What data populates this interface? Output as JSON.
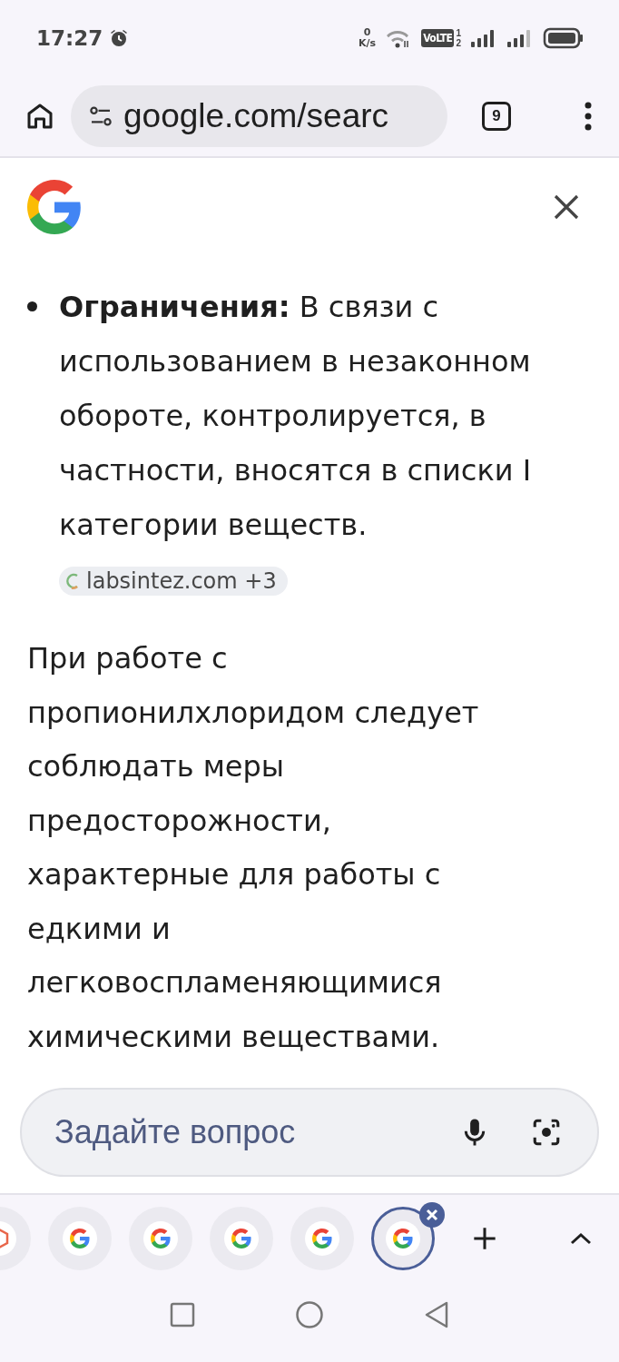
{
  "status_bar": {
    "time": "17:27",
    "net_speed_value": "0",
    "net_speed_unit": "K/s",
    "volte": "VoLTE",
    "sim_labels": [
      "1",
      "2"
    ]
  },
  "address_bar": {
    "url": "google.com/searc",
    "tab_count": "9"
  },
  "answer": {
    "bullets": [
      {
        "text": "**Ограничения:** В связи с использованием в незаконном обороте, контролируется, в частности, вносятся в списки I категории веществ.",
        "source": {
          "name": "labsintez.com",
          "extra": "+3"
        }
      }
    ],
    "paragraph": "При работе с пропионилхлоридом следует соблюдать меры предосторожности, характерные для работы с едкими и легковоспламеняющимися химическими веществами."
  },
  "ask_field": {
    "placeholder": "Задайте вопрос"
  },
  "tab_strip": [
    {
      "kind": "site",
      "selected": false
    },
    {
      "kind": "google",
      "selected": false
    },
    {
      "kind": "google",
      "selected": false
    },
    {
      "kind": "google",
      "selected": false
    },
    {
      "kind": "google",
      "selected": false
    },
    {
      "kind": "google",
      "selected": true
    }
  ]
}
